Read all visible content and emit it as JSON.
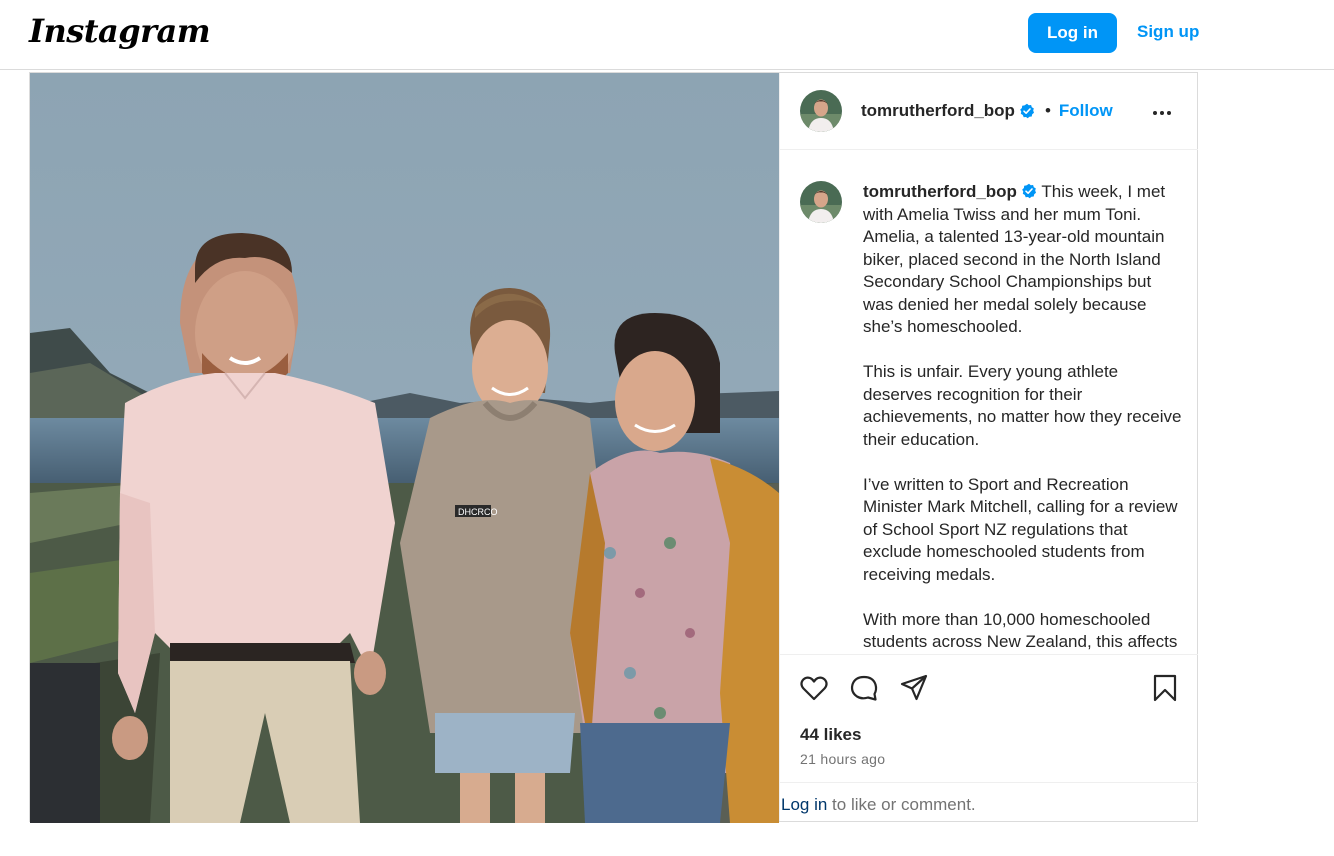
{
  "header": {
    "logo_text": "Instagram",
    "login_label": "Log in",
    "signup_label": "Sign up"
  },
  "post": {
    "username": "tomrutherford_bop",
    "verified": true,
    "follow_label": "Follow",
    "separator": "•",
    "caption_paragraphs": [
      "This week, I met with Amelia Twiss and her mum Toni. Amelia, a talented 13-year-old mountain biker, placed second in the North Island Secondary School Championships but was denied her medal solely because she’s homeschooled.",
      "This is unfair. Every young athlete deserves recognition for their achievements, no matter how they receive their education.",
      "I’ve written to Sport and Recreation Minister Mark Mitchell, calling for a review of School Sport NZ regulations that exclude homeschooled students from receiving medals.",
      "With more than 10,000 homeschooled students across New Zealand, this affects"
    ],
    "likes": "44 likes",
    "time_ago": "21 hours ago",
    "hoodie_brand": "DHCRCO"
  },
  "comment_bar": {
    "login_link": "Log in",
    "rest": " to like or comment."
  },
  "icons": [
    "heart-icon",
    "comment-icon",
    "share-icon",
    "bookmark-icon",
    "more-icon",
    "verified-badge-icon"
  ],
  "colors": {
    "accent": "#0095f6",
    "verified": "#0095f6",
    "text": "#262626",
    "muted": "#737373",
    "border": "#dbdbdb"
  }
}
